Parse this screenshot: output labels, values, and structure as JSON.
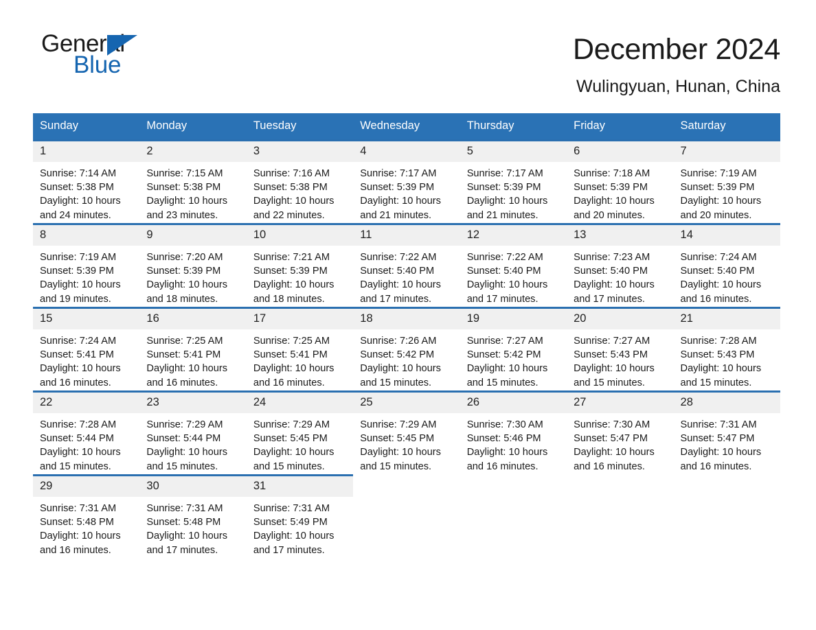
{
  "brand": {
    "word_one": "General",
    "word_two": "Blue",
    "triangle_icon": "brand-triangle-icon",
    "accent_color": "#1565b0"
  },
  "header": {
    "title": "December 2024",
    "subtitle": "Wulingyuan, Hunan, China"
  },
  "theme": {
    "header_bg": "#2a72b5",
    "row_divider": "#2a6fb0",
    "daynum_bg": "#f0f0f0",
    "page_bg": "#ffffff",
    "text": "#1a1a1a"
  },
  "calendar": {
    "weekday_headers": [
      "Sunday",
      "Monday",
      "Tuesday",
      "Wednesday",
      "Thursday",
      "Friday",
      "Saturday"
    ],
    "weeks": [
      [
        {
          "day": "1",
          "sunrise": "Sunrise: 7:14 AM",
          "sunset": "Sunset: 5:38 PM",
          "daylight": "Daylight: 10 hours and 24 minutes."
        },
        {
          "day": "2",
          "sunrise": "Sunrise: 7:15 AM",
          "sunset": "Sunset: 5:38 PM",
          "daylight": "Daylight: 10 hours and 23 minutes."
        },
        {
          "day": "3",
          "sunrise": "Sunrise: 7:16 AM",
          "sunset": "Sunset: 5:38 PM",
          "daylight": "Daylight: 10 hours and 22 minutes."
        },
        {
          "day": "4",
          "sunrise": "Sunrise: 7:17 AM",
          "sunset": "Sunset: 5:39 PM",
          "daylight": "Daylight: 10 hours and 21 minutes."
        },
        {
          "day": "5",
          "sunrise": "Sunrise: 7:17 AM",
          "sunset": "Sunset: 5:39 PM",
          "daylight": "Daylight: 10 hours and 21 minutes."
        },
        {
          "day": "6",
          "sunrise": "Sunrise: 7:18 AM",
          "sunset": "Sunset: 5:39 PM",
          "daylight": "Daylight: 10 hours and 20 minutes."
        },
        {
          "day": "7",
          "sunrise": "Sunrise: 7:19 AM",
          "sunset": "Sunset: 5:39 PM",
          "daylight": "Daylight: 10 hours and 20 minutes."
        }
      ],
      [
        {
          "day": "8",
          "sunrise": "Sunrise: 7:19 AM",
          "sunset": "Sunset: 5:39 PM",
          "daylight": "Daylight: 10 hours and 19 minutes."
        },
        {
          "day": "9",
          "sunrise": "Sunrise: 7:20 AM",
          "sunset": "Sunset: 5:39 PM",
          "daylight": "Daylight: 10 hours and 18 minutes."
        },
        {
          "day": "10",
          "sunrise": "Sunrise: 7:21 AM",
          "sunset": "Sunset: 5:39 PM",
          "daylight": "Daylight: 10 hours and 18 minutes."
        },
        {
          "day": "11",
          "sunrise": "Sunrise: 7:22 AM",
          "sunset": "Sunset: 5:40 PM",
          "daylight": "Daylight: 10 hours and 17 minutes."
        },
        {
          "day": "12",
          "sunrise": "Sunrise: 7:22 AM",
          "sunset": "Sunset: 5:40 PM",
          "daylight": "Daylight: 10 hours and 17 minutes."
        },
        {
          "day": "13",
          "sunrise": "Sunrise: 7:23 AM",
          "sunset": "Sunset: 5:40 PM",
          "daylight": "Daylight: 10 hours and 17 minutes."
        },
        {
          "day": "14",
          "sunrise": "Sunrise: 7:24 AM",
          "sunset": "Sunset: 5:40 PM",
          "daylight": "Daylight: 10 hours and 16 minutes."
        }
      ],
      [
        {
          "day": "15",
          "sunrise": "Sunrise: 7:24 AM",
          "sunset": "Sunset: 5:41 PM",
          "daylight": "Daylight: 10 hours and 16 minutes."
        },
        {
          "day": "16",
          "sunrise": "Sunrise: 7:25 AM",
          "sunset": "Sunset: 5:41 PM",
          "daylight": "Daylight: 10 hours and 16 minutes."
        },
        {
          "day": "17",
          "sunrise": "Sunrise: 7:25 AM",
          "sunset": "Sunset: 5:41 PM",
          "daylight": "Daylight: 10 hours and 16 minutes."
        },
        {
          "day": "18",
          "sunrise": "Sunrise: 7:26 AM",
          "sunset": "Sunset: 5:42 PM",
          "daylight": "Daylight: 10 hours and 15 minutes."
        },
        {
          "day": "19",
          "sunrise": "Sunrise: 7:27 AM",
          "sunset": "Sunset: 5:42 PM",
          "daylight": "Daylight: 10 hours and 15 minutes."
        },
        {
          "day": "20",
          "sunrise": "Sunrise: 7:27 AM",
          "sunset": "Sunset: 5:43 PM",
          "daylight": "Daylight: 10 hours and 15 minutes."
        },
        {
          "day": "21",
          "sunrise": "Sunrise: 7:28 AM",
          "sunset": "Sunset: 5:43 PM",
          "daylight": "Daylight: 10 hours and 15 minutes."
        }
      ],
      [
        {
          "day": "22",
          "sunrise": "Sunrise: 7:28 AM",
          "sunset": "Sunset: 5:44 PM",
          "daylight": "Daylight: 10 hours and 15 minutes."
        },
        {
          "day": "23",
          "sunrise": "Sunrise: 7:29 AM",
          "sunset": "Sunset: 5:44 PM",
          "daylight": "Daylight: 10 hours and 15 minutes."
        },
        {
          "day": "24",
          "sunrise": "Sunrise: 7:29 AM",
          "sunset": "Sunset: 5:45 PM",
          "daylight": "Daylight: 10 hours and 15 minutes."
        },
        {
          "day": "25",
          "sunrise": "Sunrise: 7:29 AM",
          "sunset": "Sunset: 5:45 PM",
          "daylight": "Daylight: 10 hours and 15 minutes."
        },
        {
          "day": "26",
          "sunrise": "Sunrise: 7:30 AM",
          "sunset": "Sunset: 5:46 PM",
          "daylight": "Daylight: 10 hours and 16 minutes."
        },
        {
          "day": "27",
          "sunrise": "Sunrise: 7:30 AM",
          "sunset": "Sunset: 5:47 PM",
          "daylight": "Daylight: 10 hours and 16 minutes."
        },
        {
          "day": "28",
          "sunrise": "Sunrise: 7:31 AM",
          "sunset": "Sunset: 5:47 PM",
          "daylight": "Daylight: 10 hours and 16 minutes."
        }
      ],
      [
        {
          "day": "29",
          "sunrise": "Sunrise: 7:31 AM",
          "sunset": "Sunset: 5:48 PM",
          "daylight": "Daylight: 10 hours and 16 minutes."
        },
        {
          "day": "30",
          "sunrise": "Sunrise: 7:31 AM",
          "sunset": "Sunset: 5:48 PM",
          "daylight": "Daylight: 10 hours and 17 minutes."
        },
        {
          "day": "31",
          "sunrise": "Sunrise: 7:31 AM",
          "sunset": "Sunset: 5:49 PM",
          "daylight": "Daylight: 10 hours and 17 minutes."
        },
        {
          "day": "",
          "sunrise": "",
          "sunset": "",
          "daylight": "",
          "empty": true
        },
        {
          "day": "",
          "sunrise": "",
          "sunset": "",
          "daylight": "",
          "empty": true
        },
        {
          "day": "",
          "sunrise": "",
          "sunset": "",
          "daylight": "",
          "empty": true
        },
        {
          "day": "",
          "sunrise": "",
          "sunset": "",
          "daylight": "",
          "empty": true
        }
      ]
    ]
  }
}
